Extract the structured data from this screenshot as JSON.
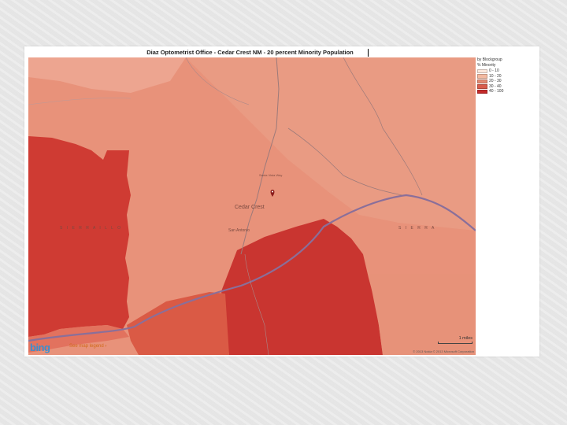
{
  "title": "Diaz Optometrist Office - Cedar Crest NM - 20 percent Minority Population",
  "legend": {
    "title_line1": "by Blockgroup",
    "title_line2": "% Minority",
    "items": [
      {
        "label": "0 - 10",
        "color": "#fbe7dc"
      },
      {
        "label": "10 - 20",
        "color": "#f3b9a1"
      },
      {
        "label": "20 - 30",
        "color": "#e48a73"
      },
      {
        "label": "30 - 40",
        "color": "#d95c4c"
      },
      {
        "label": "40 - 100",
        "color": "#c42a2a"
      }
    ]
  },
  "map": {
    "marker_icon": "map-pin-icon",
    "places": {
      "cedar_crest": "Cedar Crest",
      "san_antonio": "San Antonio",
      "sierra_left": "S I E R R A   I L L O",
      "sierra_right": "S I E R R A",
      "santa_vista": "Santa Vista Way"
    }
  },
  "scale_label": "1 miles",
  "bing": {
    "logo": "bing",
    "tag": "See map legend ›"
  },
  "attribution": "© 2013 Nokia  © 2013 Microsoft Corporation"
}
